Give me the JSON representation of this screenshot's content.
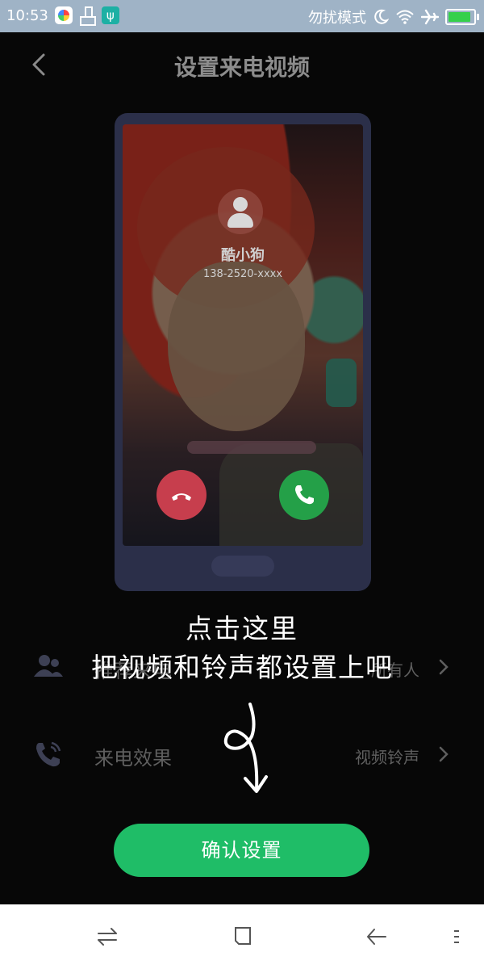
{
  "status_bar": {
    "time": "10:53",
    "mode_text": "勿扰模式",
    "icons": [
      "app-icon",
      "brush-icon",
      "usb-icon",
      "moon-icon",
      "wifi-icon",
      "airplane-icon",
      "battery-icon"
    ],
    "battery_level": 0.9,
    "battery_color": "#35d04b"
  },
  "header": {
    "title": "设置来电视频",
    "back_icon": "chevron-left-icon"
  },
  "preview": {
    "caller_name": "酷小狗",
    "caller_number": "138-2520-xxxx",
    "decline_color": "#c73e4d",
    "accept_color": "#24a048"
  },
  "settings": [
    {
      "label": "推荐来电",
      "value": "所有人",
      "icon": "contacts-icon"
    },
    {
      "label": "来电效果",
      "value": "视频铃声",
      "icon": "phone-ring-icon"
    }
  ],
  "hint": {
    "line1": "点击这里",
    "line2": "把视频和铃声都设置上吧"
  },
  "confirm_button": {
    "label": "确认设置",
    "color": "#1fbd67"
  },
  "nav_bar": {
    "icons": [
      "switch-icon",
      "home-square-icon",
      "back-arrow-icon",
      "menu-dots-icon"
    ]
  }
}
